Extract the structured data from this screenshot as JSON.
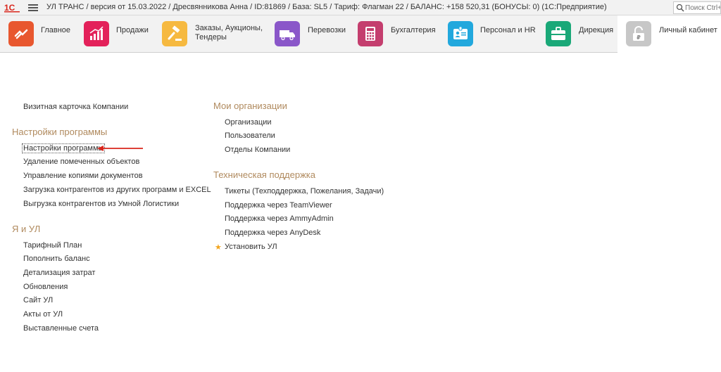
{
  "titlebar": {
    "logo_text": "1С",
    "title": "УЛ ТРАНС / версия от 15.03.2022 / Дресвянникова Анна / ID:81869 / База: SL5 / Тариф: Флагман 22 / БАЛАНС: +158 520,31 (БОНУСЫ: 0)  (1С:Предприятие)",
    "search_placeholder": "Поиск Ctrl+"
  },
  "sections": [
    {
      "label": "Главное",
      "icon": "handshake-icon",
      "color": "#e8572f"
    },
    {
      "label": "Продажи",
      "icon": "chart-growth-icon",
      "color": "#e3215a"
    },
    {
      "label_line1": "Заказы,  Аукционы,",
      "label_line2": "Тендеры",
      "icon": "gavel-icon",
      "color": "#f6b940"
    },
    {
      "label": "Перевозки",
      "icon": "truck-icon",
      "color": "#8a57c9"
    },
    {
      "label": "Бухгалтерия",
      "icon": "calculator-icon",
      "color": "#c43e6e"
    },
    {
      "label": "Персонал и HR",
      "icon": "id-card-icon",
      "color": "#22a8dd"
    },
    {
      "label": "Дирекция",
      "icon": "briefcase-icon",
      "color": "#1aa878"
    },
    {
      "label": "Личный кабинет",
      "icon": "lock-ruble-icon",
      "color": "#c7c7c7"
    }
  ],
  "left": {
    "top_link": "Визитная карточка Компании",
    "settings_title": "Настройки программы",
    "settings_links": [
      "Настройки программы",
      "Удаление помеченных объектов",
      "Управление копиями документов",
      "Загрузка контрагентов из других программ и EXCEL",
      "Выгрузка контрагентов из Умной Логистики"
    ],
    "ya_title": "Я и УЛ",
    "ya_links": [
      "Тарифный План",
      "Пополнить баланс",
      "Детализация затрат",
      "Обновления",
      "Сайт УЛ",
      "Акты от УЛ",
      "Выставленные счета"
    ]
  },
  "right": {
    "orgs_title": "Мои организации",
    "orgs_links": [
      "Организации",
      "Пользователи",
      "Отделы Компании"
    ],
    "support_title": "Техническая поддержка",
    "support_links": [
      "Тикеты (Техподдержка, Пожелания, Задачи)",
      "Поддержка через TeamViewer",
      "Поддержка через AmmyAdmin",
      "Поддержка через AnyDesk"
    ],
    "install_link": "Установить УЛ"
  }
}
